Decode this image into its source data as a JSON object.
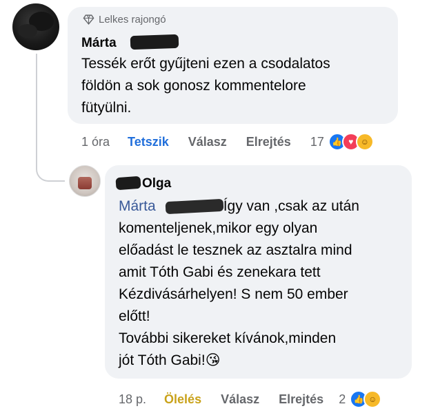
{
  "comment": {
    "badge": "Lelkes rajongó",
    "author": "Márta",
    "text": "Tessék erőt gyűjteni ezen a csodalatos\nföldön a sok gonosz kommentelore\nfütyülni.",
    "time": "1 óra",
    "like_label": "Tetszik",
    "reply_label": "Válasz",
    "hide_label": "Elrejtés",
    "reaction_count": "17",
    "reaction_icons": [
      "like-icon",
      "love-icon",
      "care-icon"
    ]
  },
  "reply": {
    "author": "Olga",
    "mention": "Márta",
    "lines": [
      "Így van ,csak az után",
      "komenteljenek,mikor egy olyan",
      "előadást le tesznek az asztalra mind",
      "amit Tóth Gabi és zenekara tett",
      "Kézdivásárhelyen!  S nem 50 ember",
      "előtt!",
      "További sikereket kívánok,minden",
      "jót Tóth Gabi!"
    ],
    "emoji": "😘",
    "time": "18 p.",
    "reaction_label": "Ölelés",
    "reply_label": "Válasz",
    "hide_label": "Elrejtés",
    "reaction_count": "2",
    "reaction_icons": [
      "like-icon",
      "care-icon"
    ]
  },
  "colors": {
    "bubble": "#f0f2f5",
    "link": "#385898",
    "like": "#216fdb",
    "care": "#c9a21a",
    "meta": "#65676b"
  }
}
